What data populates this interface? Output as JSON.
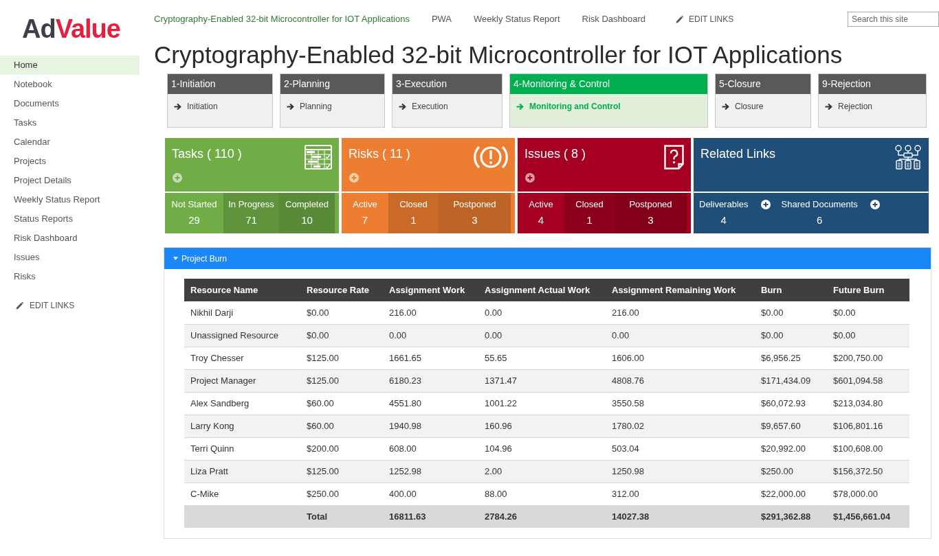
{
  "logo": {
    "parts": [
      {
        "text": "Ad",
        "color": "#3d3f4b"
      },
      {
        "text": "Value",
        "color": "#e2203f"
      }
    ]
  },
  "sidebar": {
    "items": [
      {
        "label": "Home",
        "selected": true
      },
      {
        "label": "Notebook",
        "selected": false
      },
      {
        "label": "Documents",
        "selected": false
      },
      {
        "label": "Tasks",
        "selected": false
      },
      {
        "label": "Calendar",
        "selected": false
      },
      {
        "label": "Projects",
        "selected": false
      },
      {
        "label": "Project Details",
        "selected": false
      },
      {
        "label": "Weekly Status Report",
        "selected": false
      },
      {
        "label": "Status Reports",
        "selected": false
      },
      {
        "label": "Risk Dashboard",
        "selected": false
      },
      {
        "label": "Issues",
        "selected": false
      },
      {
        "label": "Risks",
        "selected": false
      }
    ],
    "edit_links": "EDIT LINKS"
  },
  "top_nav": {
    "links": [
      {
        "label": "Cryptography-Enabled 32-bit Microcontroller for IOT Applications",
        "selected": true
      },
      {
        "label": "PWA",
        "selected": false
      },
      {
        "label": "Weekly Status Report",
        "selected": false
      },
      {
        "label": "Risk Dashboard",
        "selected": false
      }
    ],
    "edit_links": "EDIT LINKS",
    "search": {
      "placeholder": "Search this site"
    }
  },
  "page_title": "Cryptography-Enabled 32-bit Microcontroller for IOT Applications",
  "phases": [
    {
      "title": "1-Initiation",
      "link": "Initiation",
      "selected": false
    },
    {
      "title": "2-Planning",
      "link": "Planning",
      "selected": false
    },
    {
      "title": "3-Execution",
      "link": "Execution",
      "selected": false
    },
    {
      "title": "4-Monitoring & Control",
      "link": "Monitoring and Control",
      "selected": true
    },
    {
      "title": "5-Closure",
      "link": "Closure",
      "selected": false
    },
    {
      "title": "9-Rejection",
      "link": "Rejection",
      "selected": false
    }
  ],
  "tiles": [
    {
      "kind": "tasks",
      "title": "Tasks ( 110 )",
      "color": "#70ad47",
      "stats": [
        {
          "label": "Not Started",
          "value": "29"
        },
        {
          "label": "In Progress",
          "value": "71"
        },
        {
          "label": "Completed",
          "value": "10"
        }
      ]
    },
    {
      "kind": "risks",
      "title": "Risks ( 11 )",
      "color": "#ed7d31",
      "stats": [
        {
          "label": "Active",
          "value": "7"
        },
        {
          "label": "Closed",
          "value": "1"
        },
        {
          "label": "Postponed",
          "value": "3"
        }
      ]
    },
    {
      "kind": "issues",
      "title": "Issues ( 8 )",
      "color": "#a50021",
      "stats": [
        {
          "label": "Active",
          "value": "4"
        },
        {
          "label": "Closed",
          "value": "1"
        },
        {
          "label": "Postponed",
          "value": "3"
        }
      ]
    },
    {
      "kind": "links",
      "title": "Related Links",
      "color": "#1f4e79",
      "stats": [
        {
          "label": "Deliverables",
          "value": "4"
        },
        {
          "label": "Shared Documents",
          "value": "6"
        }
      ]
    }
  ],
  "panel": {
    "title": "Project Burn",
    "expanded": true,
    "table": {
      "columns": [
        "Resource Name",
        "Resource Rate",
        "Assignment Work",
        "Assignment Actual Work",
        "Assignment Remaining Work",
        "Burn",
        "Future Burn"
      ],
      "rows": [
        [
          "Nikhil Darji",
          "$0.00",
          "216.00",
          "0.00",
          "216.00",
          "$0.00",
          "$0.00"
        ],
        [
          "Unassigned Resource",
          "$0.00",
          "0.00",
          "0.00",
          "0.00",
          "$0.00",
          "$0.00"
        ],
        [
          "Troy Chesser",
          "$125.00",
          "1661.65",
          "55.65",
          "1606.00",
          "$6,956.25",
          "$200,750.00"
        ],
        [
          "Project Manager",
          "$125.00",
          "6180.23",
          "1371.47",
          "4808.76",
          "$171,434.09",
          "$601,094.58"
        ],
        [
          "Alex Sandberg",
          "$60.00",
          "4551.80",
          "1001.22",
          "3550.58",
          "$60,072.93",
          "$213,034.80"
        ],
        [
          "Larry Kong",
          "$60.00",
          "1940.98",
          "160.96",
          "1780.02",
          "$9,657.60",
          "$106,801.16"
        ],
        [
          "Terri Quinn",
          "$200.00",
          "608.00",
          "104.96",
          "503.04",
          "$20,992.00",
          "$100,608.00"
        ],
        [
          "Liza Pratt",
          "$125.00",
          "1252.98",
          "2.00",
          "1250.98",
          "$250.00",
          "$156,372.50"
        ],
        [
          "C-Mike",
          "$250.00",
          "400.00",
          "88.00",
          "312.00",
          "$22,000.00",
          "$78,000.00"
        ]
      ],
      "total_row": {
        "label": "Total",
        "cells": [
          "16811.63",
          "2784.26",
          "14027.38",
          "$291,362.88",
          "$1,456,661.04"
        ]
      }
    }
  }
}
